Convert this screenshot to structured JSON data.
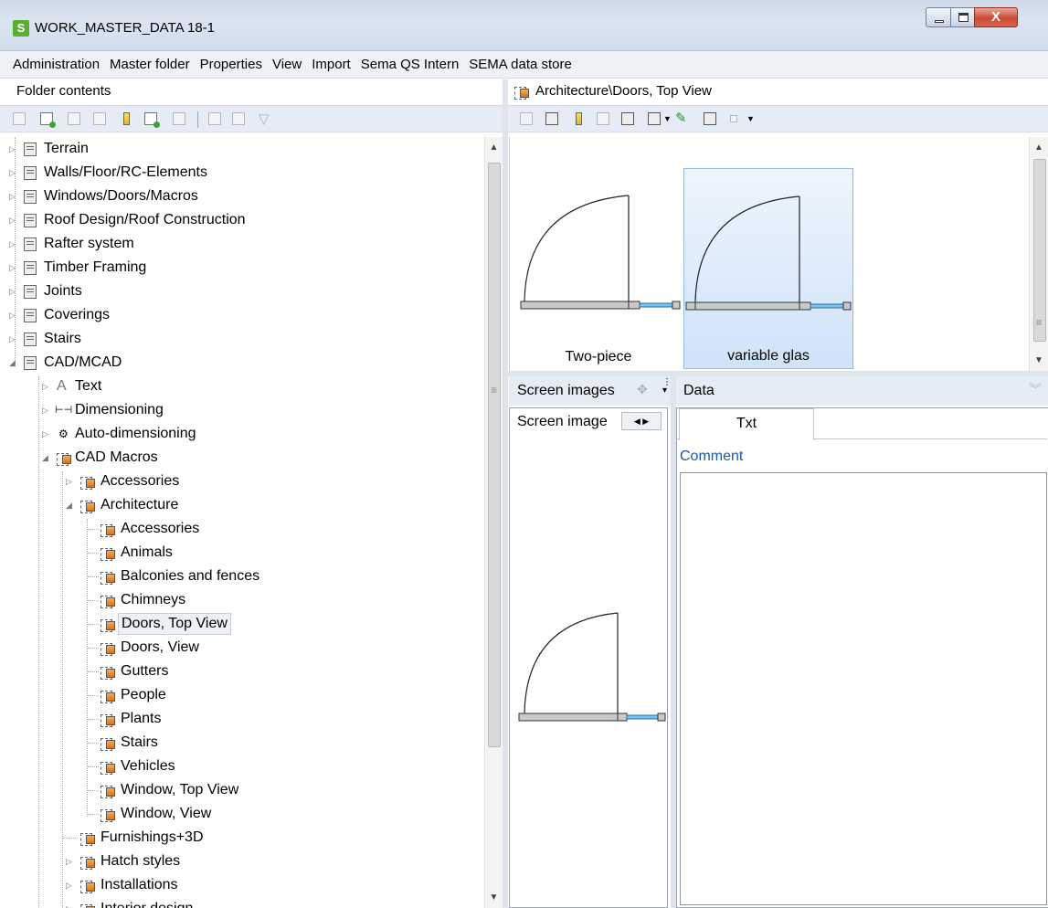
{
  "window": {
    "app_icon_letter": "S",
    "title": "WORK_MASTER_DATA 18-1",
    "close_label": "X"
  },
  "menu": [
    "Administration",
    "Master folder",
    "Properties",
    "View",
    "Import",
    "Sema QS Intern",
    "SEMA data store"
  ],
  "left_panel": {
    "header": "Folder contents"
  },
  "right_panel": {
    "breadcrumb": "Architecture\\Doors, Top View"
  },
  "tree": {
    "top_level": [
      "Terrain",
      "Walls/Floor/RC-Elements",
      "Windows/Doors/Macros",
      "Roof Design/Roof Construction",
      "Rafter system",
      "Timber Framing",
      "Joints",
      "Coverings",
      "Stairs",
      "CAD/MCAD"
    ],
    "cad_children": [
      "Text",
      "Dimensioning",
      "Auto-dimensioning",
      "CAD Macros"
    ],
    "text_glyph": "A",
    "macro_children": [
      "Accessories",
      "Architecture"
    ],
    "architecture_children": [
      "Accessories",
      "Animals",
      "Balconies and fences",
      "Chimneys",
      "Doors, Top View",
      "Doors, View",
      "Gutters",
      "People",
      "Plants",
      "Stairs",
      "Vehicles",
      "Window, Top View",
      "Window, View"
    ],
    "selected": "Doors, Top View",
    "after_architecture": [
      "Furnishings+3D",
      "Hatch styles",
      "Installations",
      "Interior design"
    ]
  },
  "preview": {
    "tiles": [
      {
        "caption": "Two-piece",
        "selected": false
      },
      {
        "caption": "variable glas",
        "selected": true
      }
    ]
  },
  "screen_images": {
    "header": "Screen images",
    "tab": "Screen image"
  },
  "data_panel": {
    "header": "Data",
    "tab": "Txt",
    "comment_label": "Comment",
    "comment_value": ""
  }
}
